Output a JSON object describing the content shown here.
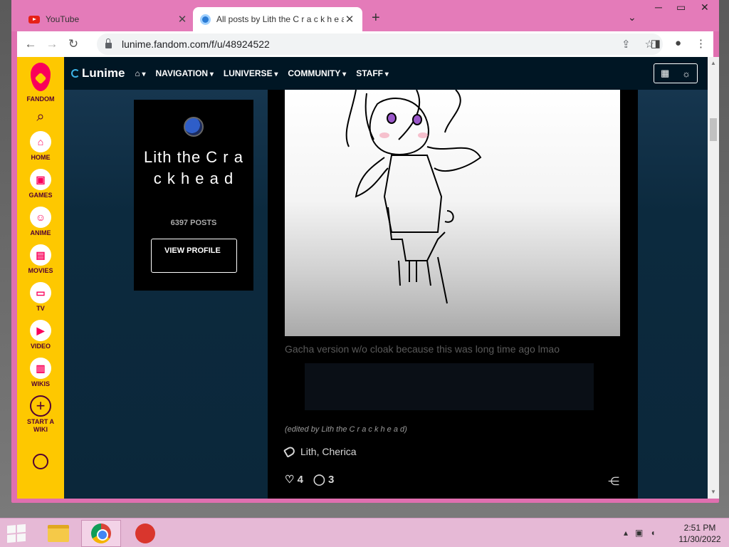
{
  "browser": {
    "tabs": [
      {
        "title": "YouTube",
        "active": false
      },
      {
        "title": "All posts by Lith the C r a c k h e a d",
        "active": true
      }
    ],
    "new_tab": "+",
    "url": "lunime.fandom.com/f/u/48924522"
  },
  "fandom_rail": {
    "brand": "FANDOM",
    "items": [
      {
        "label": "HOME"
      },
      {
        "label": "GAMES"
      },
      {
        "label": "ANIME"
      },
      {
        "label": "MOVIES"
      },
      {
        "label": "TV"
      },
      {
        "label": "VIDEO"
      },
      {
        "label": "WIKIS"
      },
      {
        "label": "START A WIKI"
      }
    ]
  },
  "wiki_nav": {
    "logo": "Lunime",
    "menus": [
      "NAVIGATION",
      "LUNIVERSE",
      "COMMUNITY",
      "STAFF"
    ]
  },
  "profile": {
    "name": "Lith the C r a c k h e a d",
    "posts": "6397 POSTS",
    "view_profile": "VIEW PROFILE"
  },
  "post": {
    "caption": "Gacha version w/o cloak because this was long time ago lmao",
    "edited": "(edited by Lith the C r a c k h e a d)",
    "tags": "Lith, Cherica",
    "likes": "4",
    "comments": "3"
  },
  "taskbar": {
    "time": "2:51 PM",
    "date": "11/30/2022"
  }
}
